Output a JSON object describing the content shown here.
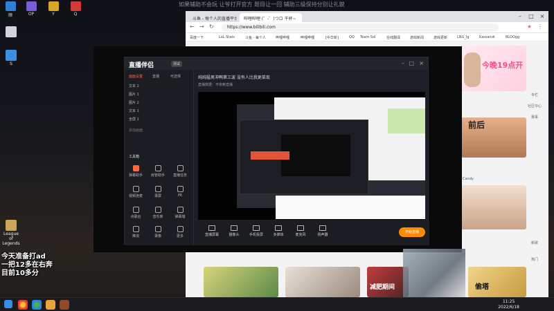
{
  "marquee": "如果辅助不会玩 让爷打开官方 题目让一回 辅助三级保持分别让礼貌",
  "desktop_top_icons": [
    {
      "label": "顺",
      "color": "#2f7fd8"
    },
    {
      "label": "OP",
      "color": "#7a5cd6"
    },
    {
      "label": "Y",
      "color": "#d4a62a"
    },
    {
      "label": "Q",
      "color": "#d23a3a"
    }
  ],
  "desktop_icons": [
    {
      "label": "S",
      "color": "#3d8ee0"
    },
    {
      "label": "League of Legends",
      "color": "#c9a857"
    },
    {
      "label": "",
      "color": "#8d3c3c"
    }
  ],
  "browser": {
    "tabs": [
      "斗鱼 - 每个人的直播平台",
      "哔哩哔哩 (゜-゜)つロ 干杯~"
    ],
    "url": "https://www.bilibili.com",
    "bookmarks": [
      "百度一下",
      "LoL Stats",
      "斗鱼 - 每个人",
      "哔哩哔哩",
      "哔哩哔哩",
      "[中华新]",
      "QQ",
      "Team Sol",
      "在线翻译",
      "游戏新闻",
      "游戏更新",
      "LNG_Ig",
      "Kassandr",
      "BLOOgg"
    ]
  },
  "app": {
    "logo": "直播伴侣",
    "badge": "测试",
    "sidebar_tabs": [
      "画面设置",
      "直播",
      "可选择"
    ],
    "sources": [
      "文本 2",
      "图片 1",
      "图片 2",
      "文本 1",
      "全屏 1",
      "添加画面"
    ],
    "tools_title": "工具箱",
    "tools": [
      "弹幕助手",
      "房管助手",
      "直播任务",
      "视频连麦",
      "录屏",
      "PK",
      "点歌台",
      "音乐库",
      "弹幕墙",
      "推流",
      "录像",
      "更多"
    ],
    "room_title": "纯纯猛男冲鸭第三波 没有人比我更菜现",
    "room_sub": "直播数据：不依赖直播",
    "controls": [
      "直播屏幕",
      "摄像头",
      "手机投屏",
      "多媒体",
      "麦克风",
      "扬声器"
    ],
    "start_label": "开始直播"
  },
  "right": {
    "banner": "今晚19点开",
    "side_nav": [
      "专栏",
      "社区中心",
      "赛事",
      "直播",
      "课堂",
      "新歌",
      "热门"
    ],
    "caption1": "前后",
    "video_title": "减肥期间",
    "video_title2": "偷塔",
    "user": "Candy"
  },
  "overlay_text": [
    "今天准备打ad",
    "一把12多在右奔",
    "目前10多分"
  ],
  "taskbar": {
    "time": "11:25",
    "date": "2022/6/18"
  }
}
